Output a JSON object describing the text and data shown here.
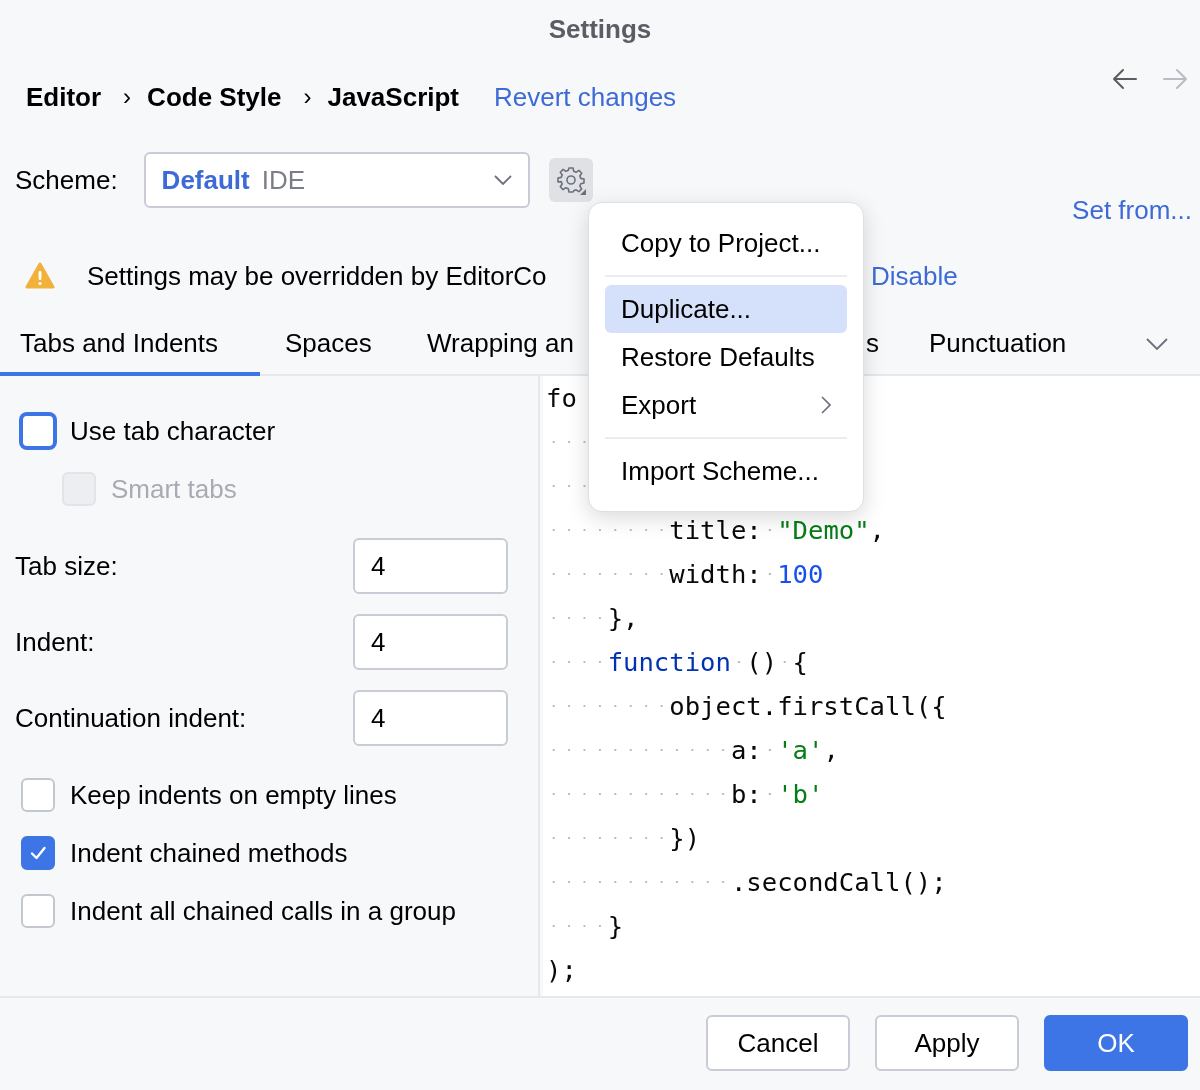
{
  "window": {
    "title": "Settings"
  },
  "breadcrumb": [
    "Editor",
    "Code Style",
    "JavaScript"
  ],
  "breadcrumb_separator": "›",
  "revert_link": "Revert changes",
  "nav": [
    {
      "kind": "back",
      "disabled": false
    },
    {
      "kind": "forward",
      "disabled": true
    }
  ],
  "scheme": {
    "label": "Scheme:",
    "name": "Default",
    "location": "IDE"
  },
  "set_from_link": "Set from...",
  "warning": {
    "text": "Settings may be overridden by EditorCo",
    "link": "Disable"
  },
  "tabs": [
    {
      "label": "Tabs and Indents",
      "selected": true
    },
    {
      "label": "Spaces",
      "selected": false
    },
    {
      "label": "Wrapping an",
      "selected": false
    },
    {
      "label": "s",
      "selected": false
    },
    {
      "label": "Punctuation",
      "selected": false
    }
  ],
  "options": [
    {
      "kind": "checkbox",
      "label": "Use tab character",
      "checked": false,
      "focused": true,
      "disabled": false,
      "children": [
        {
          "kind": "checkbox",
          "label": "Smart tabs",
          "checked": false,
          "focused": false,
          "disabled": true
        }
      ]
    },
    {
      "kind": "number",
      "label": "Tab size:",
      "value": "4"
    },
    {
      "kind": "number",
      "label": "Indent:",
      "value": "4"
    },
    {
      "kind": "number",
      "label": "Continuation indent:",
      "value": "4"
    },
    {
      "kind": "checkbox",
      "label": "Keep indents on empty lines",
      "checked": false,
      "focused": false,
      "disabled": false
    },
    {
      "kind": "checkbox",
      "label": "Indent chained methods",
      "checked": true,
      "focused": false,
      "disabled": false
    },
    {
      "kind": "checkbox",
      "label": "Indent all chained calls in a group",
      "checked": false,
      "focused": false,
      "disabled": false
    }
  ],
  "code": [
    {
      "kind": "text",
      "tokens": [
        {
          "text": "fo",
          "kind": "plain"
        }
      ]
    },
    {
      "kind": "hidden"
    },
    {
      "kind": "hidden"
    },
    {
      "kind": "text",
      "tokens": [
        {
          "text": "        title: ",
          "kind": "plain"
        },
        {
          "text": "\"Demo\"",
          "kind": "string"
        },
        {
          "text": ",",
          "kind": "plain"
        }
      ]
    },
    {
      "kind": "text",
      "tokens": [
        {
          "text": "        width: ",
          "kind": "plain"
        },
        {
          "text": "100",
          "kind": "number"
        }
      ]
    },
    {
      "kind": "text",
      "tokens": [
        {
          "text": "    },",
          "kind": "plain"
        }
      ]
    },
    {
      "kind": "text",
      "tokens": [
        {
          "text": "    function",
          "kind": "keyword"
        },
        {
          "text": " () {",
          "kind": "plain"
        }
      ]
    },
    {
      "kind": "text",
      "tokens": [
        {
          "text": "        object.firstCall({",
          "kind": "plain"
        }
      ]
    },
    {
      "kind": "text",
      "tokens": [
        {
          "text": "            a: ",
          "kind": "plain"
        },
        {
          "text": "'a'",
          "kind": "string"
        },
        {
          "text": ",",
          "kind": "plain"
        }
      ]
    },
    {
      "kind": "text",
      "tokens": [
        {
          "text": "            b: ",
          "kind": "plain"
        },
        {
          "text": "'b'",
          "kind": "string"
        }
      ]
    },
    {
      "kind": "text",
      "tokens": [
        {
          "text": "        })",
          "kind": "plain"
        }
      ]
    },
    {
      "kind": "text",
      "tokens": [
        {
          "text": "            .secondCall();",
          "kind": "plain"
        }
      ]
    },
    {
      "kind": "text",
      "tokens": [
        {
          "text": "    }",
          "kind": "plain"
        }
      ]
    },
    {
      "kind": "text",
      "tokens": [
        {
          "text": ");",
          "kind": "plain"
        }
      ]
    }
  ],
  "menu": [
    {
      "kind": "item",
      "label": "Copy to Project...",
      "selected": false
    },
    {
      "kind": "separator"
    },
    {
      "kind": "item",
      "label": "Duplicate...",
      "selected": true
    },
    {
      "kind": "item",
      "label": "Restore Defaults",
      "selected": false
    },
    {
      "kind": "submenu",
      "label": "Export",
      "selected": false
    },
    {
      "kind": "separator"
    },
    {
      "kind": "item",
      "label": "Import Scheme...",
      "selected": false
    }
  ],
  "buttons": [
    {
      "label": "Cancel",
      "kind": "secondary"
    },
    {
      "label": "Apply",
      "kind": "secondary"
    },
    {
      "label": "OK",
      "kind": "primary"
    }
  ]
}
